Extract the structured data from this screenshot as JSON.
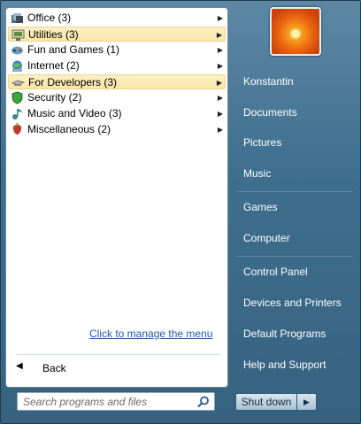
{
  "categories": [
    {
      "label": "Office (3)",
      "icon": "office-icon",
      "highlighted": false
    },
    {
      "label": "Utilities (3)",
      "icon": "utilities-icon",
      "highlighted": true
    },
    {
      "label": "Fun and Games (1)",
      "icon": "games-icon",
      "highlighted": false
    },
    {
      "label": "Internet (2)",
      "icon": "internet-icon",
      "highlighted": false
    },
    {
      "label": "For Developers (3)",
      "icon": "developers-icon",
      "highlighted": true
    },
    {
      "label": "Security (2)",
      "icon": "security-icon",
      "highlighted": false
    },
    {
      "label": "Music and Video (3)",
      "icon": "music-video-icon",
      "highlighted": false
    },
    {
      "label": "Miscellaneous (2)",
      "icon": "misc-icon",
      "highlighted": false
    }
  ],
  "manage_link": "Click to manage the menu",
  "back_label": "Back",
  "search": {
    "placeholder": "Search programs and files",
    "value": ""
  },
  "right_items": [
    {
      "label": "Konstantin"
    },
    {
      "label": "Documents"
    },
    {
      "label": "Pictures"
    },
    {
      "label": "Music"
    },
    {
      "label": "Games"
    },
    {
      "label": "Computer"
    },
    {
      "label": "Control Panel"
    },
    {
      "label": "Devices and Printers"
    },
    {
      "label": "Default Programs"
    },
    {
      "label": "Help and Support"
    }
  ],
  "shutdown_label": "Shut down",
  "colors": {
    "accent": "#1e5aa6",
    "highlight": "#fbe9b0",
    "panel": "#3f6f8f"
  }
}
